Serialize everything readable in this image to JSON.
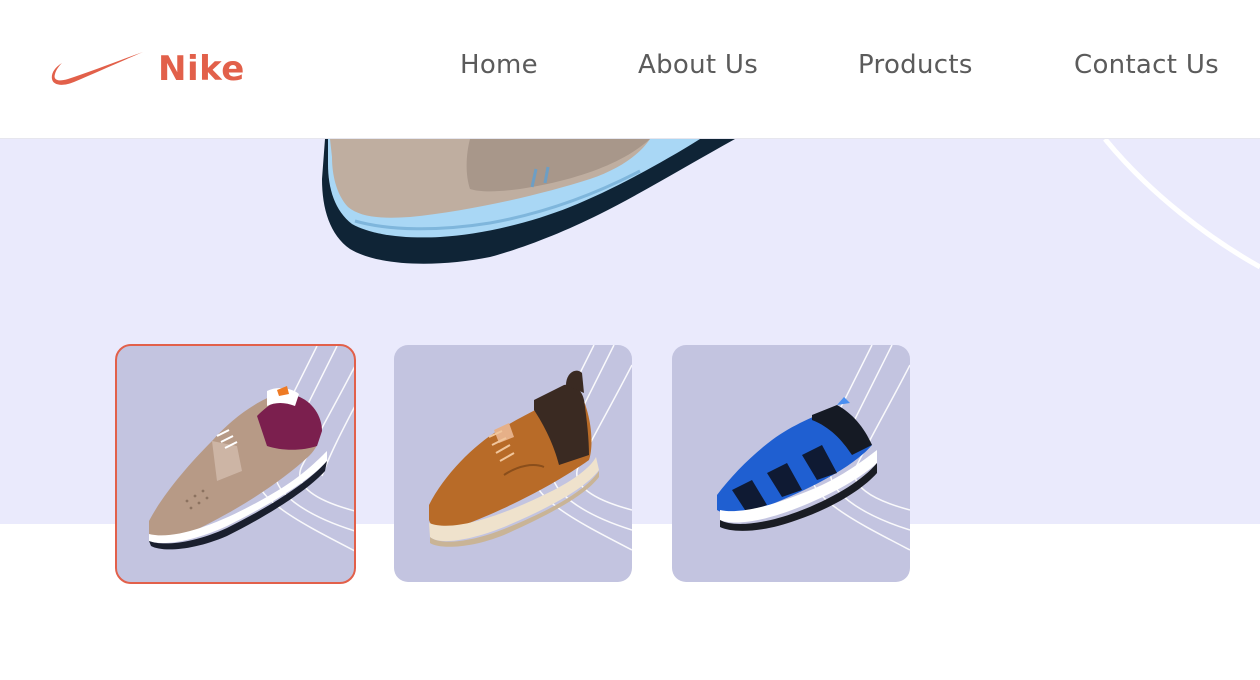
{
  "header": {
    "brand": "Nike",
    "brand_icon": "nike-swoosh-icon",
    "brand_color": "#e2604a",
    "nav": [
      {
        "label": "Home"
      },
      {
        "label": "About Us"
      },
      {
        "label": "Products"
      },
      {
        "label": "Contact Us"
      }
    ]
  },
  "hero": {
    "background": "#eaeafc",
    "image": "shoe-closeup-image"
  },
  "thumbnails": [
    {
      "name": "tan-runner-shoe",
      "selected": true
    },
    {
      "name": "brown-sneaker-shoe",
      "selected": false
    },
    {
      "name": "blue-trail-shoe",
      "selected": false
    }
  ],
  "colors": {
    "accent": "#e2604a",
    "thumb_bg": "#c3c4e0",
    "nav_text": "#5b5b5b"
  }
}
